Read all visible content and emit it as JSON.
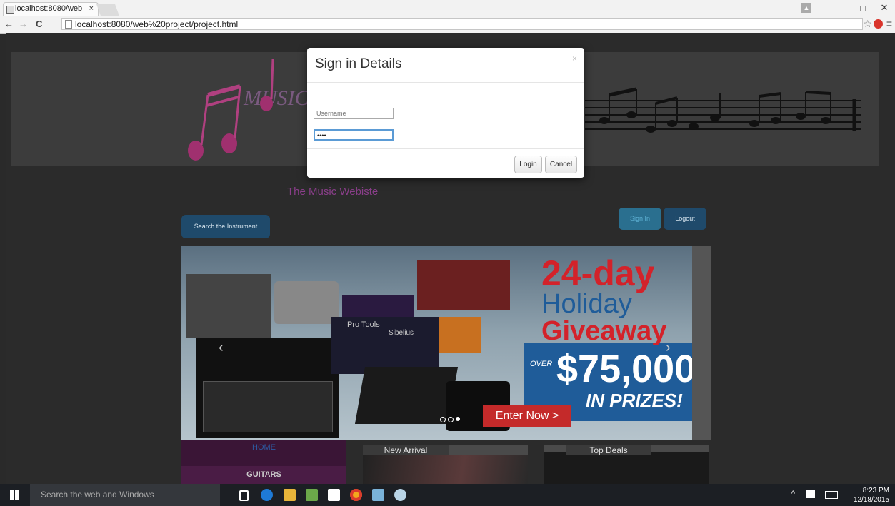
{
  "browser": {
    "tab_title": "localhost:8080/web",
    "tab_close": "×",
    "url": "localhost:8080/web%20project/project.html",
    "back": "←",
    "forward": "→",
    "reload": "C",
    "star": "☆",
    "menu": "≡",
    "win_min": "—",
    "win_max": "□",
    "win_close": "✕"
  },
  "page": {
    "logo_word": "MUSIC",
    "site_title": "The Music Webiste",
    "search_button": "Search the Instrument",
    "signin_button": "Sign In",
    "logout_button": "Logout",
    "banner": {
      "line1": "24-day",
      "line2": "Holiday",
      "line3": "Giveaway",
      "over": "OVER",
      "amount": "$75,000",
      "prizes": "IN PRIZES!",
      "cta": "Enter Now >",
      "brand1": "Pro Tools",
      "brand2": "Sibelius"
    },
    "left_nav": {
      "home": "HOME",
      "guitars": "GUITARS"
    },
    "cards": {
      "new_arrival": "New Arrival",
      "top_deals": "Top Deals"
    }
  },
  "modal": {
    "title": "Sign in Details",
    "close": "×",
    "username_placeholder": "Username",
    "password_value": "••••",
    "login": "Login",
    "cancel": "Cancel"
  },
  "taskbar": {
    "search_placeholder": "Search the web and Windows",
    "time": "8:23 PM",
    "date": "12/18/2015"
  },
  "colors": {
    "banner_red": "#d3222a",
    "banner_blue": "#1f5c99",
    "site_title": "#8a3e8a",
    "button_dark": "#1f4a6b",
    "button_signin": "#2a6f8f"
  }
}
